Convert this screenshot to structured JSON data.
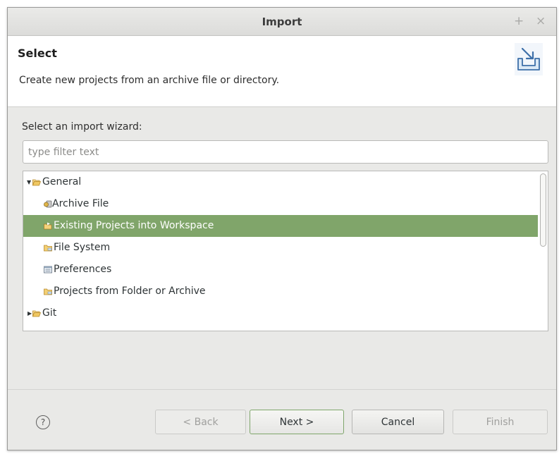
{
  "window": {
    "title": "Import",
    "buttons": {
      "maximize": "+",
      "close": "×"
    }
  },
  "header": {
    "title": "Select",
    "description": "Create new projects from an archive file or directory.",
    "icon": "import-wizard-icon"
  },
  "wizard": {
    "label": "Select an import wizard:",
    "filter": {
      "placeholder": "type filter text",
      "value": ""
    }
  },
  "tree": {
    "items": [
      {
        "label": "General",
        "level": 0,
        "expanded": true,
        "icon": "folder-open-icon"
      },
      {
        "label": "Archive File",
        "level": 1,
        "icon": "archive-file-icon"
      },
      {
        "label": "Existing Projects into Workspace",
        "level": 1,
        "icon": "existing-projects-icon",
        "selected": true
      },
      {
        "label": "File System",
        "level": 1,
        "icon": "folder-icon"
      },
      {
        "label": "Preferences",
        "level": 1,
        "icon": "preferences-icon"
      },
      {
        "label": "Projects from Folder or Archive",
        "level": 1,
        "icon": "folder-icon"
      },
      {
        "label": "Git",
        "level": 0,
        "expanded": false,
        "icon": "folder-open-icon"
      }
    ]
  },
  "footer": {
    "help": "?",
    "back": "< Back",
    "next": "Next >",
    "cancel": "Cancel",
    "finish": "Finish"
  },
  "colors": {
    "selection": "#80a56a",
    "default_button_border": "#7fa66b",
    "dialog_background": "#e9e9e7"
  }
}
